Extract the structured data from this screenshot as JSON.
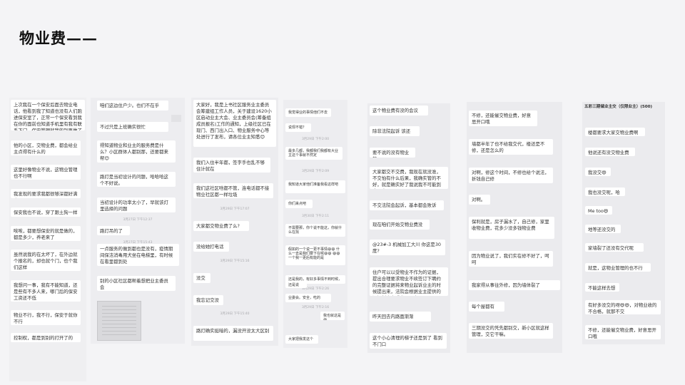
{
  "page": {
    "title": "物业费——"
  },
  "columns": [
    {
      "id": "c1",
      "messages": [
        "上次我在一个保安后面去物业电话，他看到我了知道也没有人们跑进保安室了，正常一个保安看到我在你的面前也知道手机里有我有联系下门，保安管理就我的别再做了",
        "他的小区，交物业费，都会给业主点得有什么的",
        "这里好像物业不说，这物业管理也不行啊",
        "我发现的要求我都很够深都好满意",
        "保安我也不说，穿了跟土狗一样",
        "唉唉，都要想保安的就是做的，都是多少，养老来了",
        "虽然说我的在太坏了，在外边就个报名的，却也就个门，也个我们这样",
        "我想问一事，我有不能知道，还是些有不多人来，哪门后的保安工资还不低",
        "物业不行，我不行，保安于就你不行",
        "控制权，都是到别的打开了的"
      ]
    },
    {
      "id": "c2",
      "messages": [
        "咱们这边住户少。也们不在乎",
        "不过只是上班确实很忙",
        "得知道物业和业主的服务费是什么？小区群体人都别那，还要都来帮😊",
        "路灯是当初设计的问题，哈哈哈这个不好说。",
        "当初设计的功率太小了，早就该灯里选择的问题",
        "路灯吊的了",
        "一点服务的做到都也是没有，疫情期间保洁消毒用犬坐在电梯里，有时候在看里都到处",
        "别的小区社区都帮着想把业主委员会"
      ],
      "times": [
        "3月27日 下午12:37",
        "3月27日 下午15:43"
      ]
    },
    {
      "id": "c3",
      "messages": [
        "大家好，我是上书社区服务业主委员会筹建组工作人员，关于建设1620小区启动业主大会、业主委员会(筹备组成员报名)工作的通知，上级社区已在现门、西门出入口、物业服务中心等处进行了发布，请各位业主知悉😊",
        "我们入住半年都，签字手也乱不够 住计就在",
        "我们这社区啥都不管，连电话都不接 物业社区都一样垃圾",
        "大家都交物业费了么?",
        "没给她打电话",
        "没交",
        "我忘记交没",
        "路灯确实挺暗的，漏没开没太大区别"
      ],
      "times": [
        "3月29日 下午17:07",
        "3月29日 下午15:16",
        "3月29日 下午15:40"
      ]
    },
    {
      "id": "c4",
      "messages": [
        "我觉得业的事情他们不去",
        "说现不错？",
        "最多几都，我都我们我都有大业主这个事就不然定",
        "我知道大家他们准备我看这样吧",
        "你们来点吧",
        "不需要那，你个说不能这，你就什么在找",
        "假如的一个说一更不事情😄😄 什么一去是我们要下在呢😄😄 😄😄 一个我一更后有能的是",
        "还是我的，有好多事情不到时候，一再一会",
        "还是说",
        "业委会。安全，吃的",
        "我也就这是😄",
        "大家把我发这个"
      ],
      "times": [
        "3月29日 下午2:00",
        "3月29日 下午2:09",
        "3月30日 下午2:11",
        "3月29日 下午2:26",
        "3月29日 下午2:16"
      ]
    },
    {
      "id": "c5",
      "messages": [
        "这个物业费有没的会议",
        "除非法院起诉 该还",
        "要不说的没有物业的",
        "大家都交不交费，我现在就没准，不交怕有什么后果，我确实管的不好，就是确实好了我说我不可能到大下去了",
        "不交法院会起诉，基本都会败诉",
        "现在咱们开始交物业费没",
        "@23#-3 机械加工大川  你这是30度?",
        "住户可以以受物业不作为的证据，提出合理要求物业不续签订下聘约的完整证据将来物业起诉业主的时候提出来，法院会根据业主提供的证据判少交或者是不交",
        "昨天回去内路面渐渐",
        "这个小心清理的梯子还是到了 看到不门口"
      ]
    },
    {
      "id": "c6",
      "messages": [
        "不修，还能催交物业费，好意思开口哦",
        "墙都半年了也不给我交代，楼还是不修，还是怎么的",
        "对啊，修这个时间，不修也给个说法，折钱自己修",
        "对啊。",
        "保利就是，房子漏水了，自己修，家里收物业费，花多少没多钱物业费",
        "因为物业说了，我们实在修不好了，呵呵",
        "我家得从事往外修，因为墙体裂了",
        "每个屋都有",
        "三期没交的凭先都别交，新小区就这样管理，交它干嘛。"
      ]
    },
    {
      "id": "c7",
      "header": "五彩三期储业主交（仅限业主）(500)",
      "messages": [
        "楼都要求大家交物业费啊",
        "他说还有没交物业费",
        "我没交😄",
        "我也没交呢，哈哈",
        "Me too😄",
        "地等还没交的",
        "家墙裂了还没有交代呢",
        "就是，这物业管理的也不行",
        "不能这样去想",
        "有好多没交的呀😄😄，对物业收的不合格，就那不交",
        "不修，还能催交物业费，好意思开口哦"
      ]
    }
  ]
}
